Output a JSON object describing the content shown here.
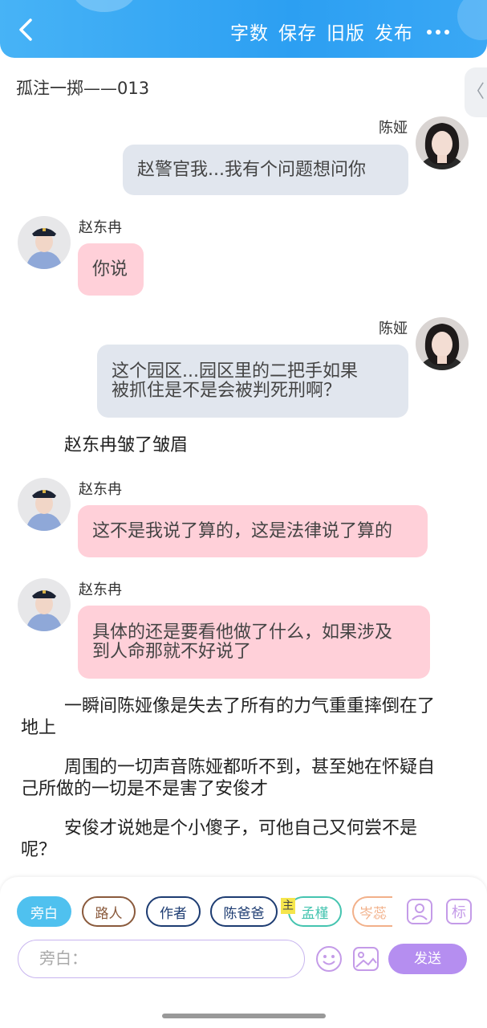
{
  "header": {
    "word_count": "字数",
    "save": "保存",
    "old_version": "旧版",
    "publish": "发布"
  },
  "side_tab": "〈",
  "doc_title": "孤注一掷——013",
  "messages": [
    {
      "speaker": "陈娅",
      "text": "赵警官我...我有个问题想问你"
    },
    {
      "speaker": "赵东冉",
      "text": "你说"
    },
    {
      "speaker": "陈娅",
      "lines": [
        "这个园区...园区里的二把手如果",
        "被抓住是不是会被判死刑啊？"
      ]
    },
    {
      "narration": "赵东冉皱了皱眉"
    },
    {
      "speaker": "赵东冉",
      "text": "这不是我说了算的，这是法律说了算的"
    },
    {
      "speaker": "赵东冉",
      "lines": [
        "具体的还是要看他做了什么，如果涉及",
        "到人命那就不好说了"
      ]
    },
    {
      "narration_lines": [
        "一瞬间陈娅像是失去了所有的力气重重摔倒在了",
        "地上"
      ]
    },
    {
      "narration_lines": [
        "周围的一切声音陈娅都听不到，甚至她在怀疑自",
        "己所做的一切是不是害了安俊才"
      ]
    },
    {
      "narration_lines": [
        "安俊才说她是个小傻子，可他自己又何尝不是",
        "呢？"
      ]
    }
  ],
  "chips": [
    "旁白",
    "路人",
    "作者",
    "陈爸爸",
    "孟槿",
    "岑蕊"
  ],
  "main_badge": "主",
  "input_placeholder": "旁白：",
  "send_label": "发送",
  "tag_icon_label": "标",
  "colors": {
    "header": "#2c9ff2",
    "grey_bubble": "#e1e6ee",
    "pink_bubble": "#ffd0d9",
    "send": "#b58ef0",
    "active_chip": "#4fc1ef"
  }
}
